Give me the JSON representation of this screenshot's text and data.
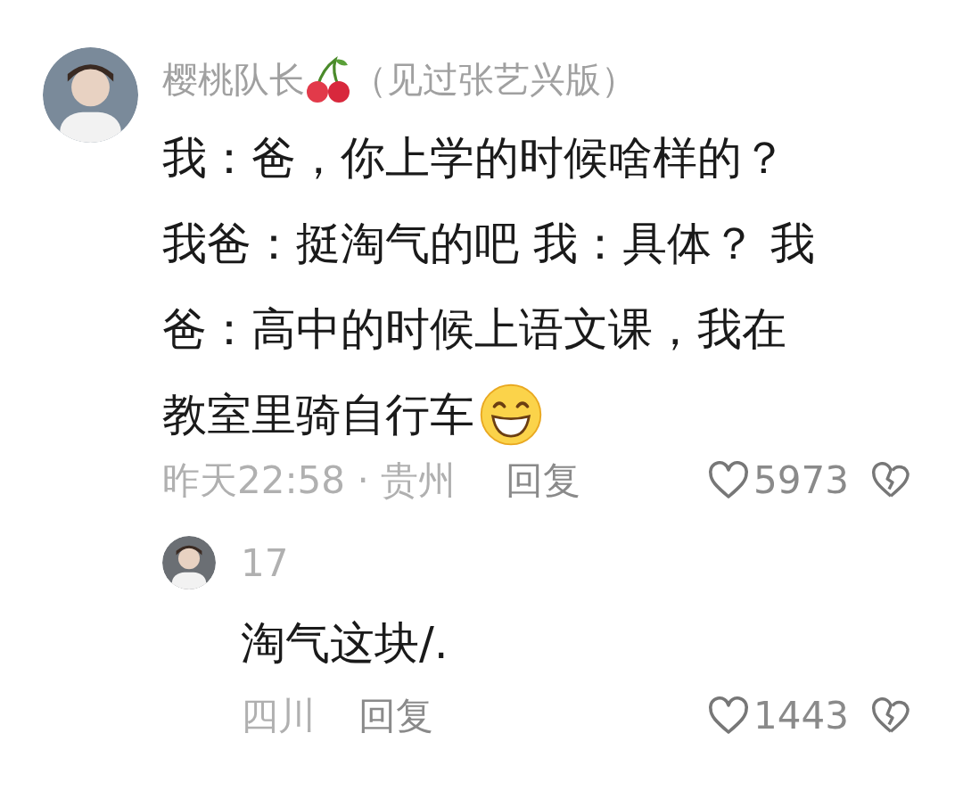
{
  "comments": [
    {
      "author": "樱桃队长",
      "author_note": "（见过张艺兴版）",
      "text_lines": [
        "我：爸，你上学的时候啥样的？",
        "我爸：挺淘气的吧 我：具体？ 我",
        "爸：高中的时候上语文课，我在",
        "教室里骑自行车"
      ],
      "time": "昨天22:58 · 贵州",
      "reply_label": "回复",
      "likes": "5973",
      "replies": [
        {
          "author": "17",
          "text": "淘气这块/.",
          "time": "四川",
          "reply_label": "回复",
          "likes": "1443"
        }
      ]
    }
  ]
}
